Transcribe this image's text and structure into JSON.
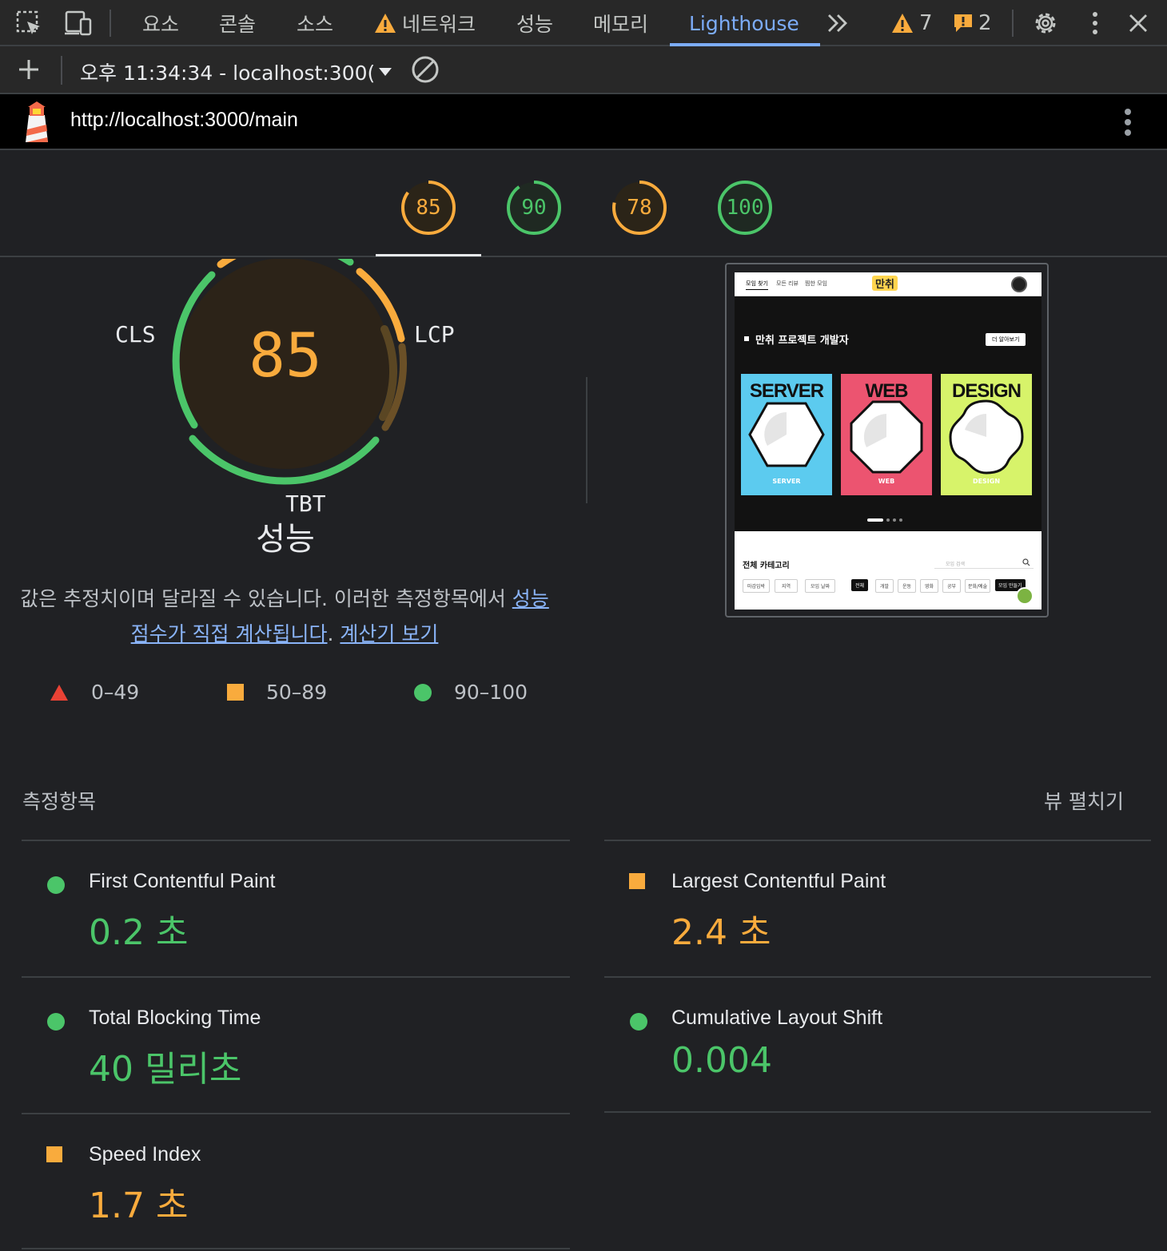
{
  "toolbar": {
    "tabs": [
      "요소",
      "콘솔",
      "소스",
      "네트워크",
      "성능",
      "메모리",
      "Lighthouse"
    ],
    "more_tabs_icon": "double-chevron-right-icon",
    "warning_count": "7",
    "error_count": "2"
  },
  "session": {
    "report_label": "오후 11:34:34 - localhost:300(",
    "add_icon": "plus-icon",
    "clear_icon": "block-icon"
  },
  "url_bar": {
    "url": "http://localhost:3000/main"
  },
  "category_scores": [
    {
      "score": "85",
      "status": "average"
    },
    {
      "score": "90",
      "status": "pass"
    },
    {
      "score": "78",
      "status": "average"
    },
    {
      "score": "100",
      "status": "pass"
    }
  ],
  "main_gauge": {
    "score": "85",
    "labels": {
      "cls": "CLS",
      "lcp": "LCP",
      "tbt": "TBT"
    },
    "title": "성능"
  },
  "description": {
    "text": "값은 추정치이며 달라질 수 있습니다. 이러한 측정항목에서 ",
    "link1": "성능 점수가 직접 계산됩니다",
    "sep": ". ",
    "link2": "계산기 보기"
  },
  "legend": [
    {
      "range": "0–49",
      "shape": "triangle",
      "color": "#e94235"
    },
    {
      "range": "50–89",
      "shape": "square",
      "color": "#f9ab3d"
    },
    {
      "range": "90–100",
      "shape": "circle",
      "color": "#4bc569"
    }
  ],
  "screenshot": {
    "nav": [
      "모임 찾기",
      "모든 리뷰",
      "찜한 모임"
    ],
    "logo": "만취",
    "heading": "만취 프로젝트 개발자",
    "more_button": "더 알아보기",
    "cards": [
      {
        "title": "SERVER",
        "label": "SERVER",
        "color": "#5ccbef"
      },
      {
        "title": "WEB",
        "label": "WEB",
        "color": "#ec5470"
      },
      {
        "title": "DESIGN",
        "label": "DESIGN",
        "color": "#d7f36a"
      }
    ],
    "category_title": "전체 카테고리",
    "search_placeholder": "모임 검색",
    "filters": [
      "마감임박",
      "지역",
      "모임 날짜"
    ],
    "chips": [
      "전체",
      "개발",
      "운동",
      "영화",
      "공부",
      "문화/예술",
      "모임 만들기"
    ]
  },
  "metrics_section": {
    "title": "측정항목",
    "expand_label": "뷰 펼치기"
  },
  "metrics": [
    {
      "name": "First Contentful Paint",
      "value": "0.2 초",
      "status": "pass"
    },
    {
      "name": "Largest Contentful Paint",
      "value": "2.4 초",
      "status": "average"
    },
    {
      "name": "Total Blocking Time",
      "value": "40 밀리초",
      "status": "pass"
    },
    {
      "name": "Cumulative Layout Shift",
      "value": "0.004",
      "status": "pass"
    },
    {
      "name": "Speed Index",
      "value": "1.7 초",
      "status": "average"
    }
  ],
  "colors": {
    "pass": "#4bc569",
    "average": "#f9ab3d",
    "fail": "#e94235",
    "accent": "#7cacf8"
  }
}
